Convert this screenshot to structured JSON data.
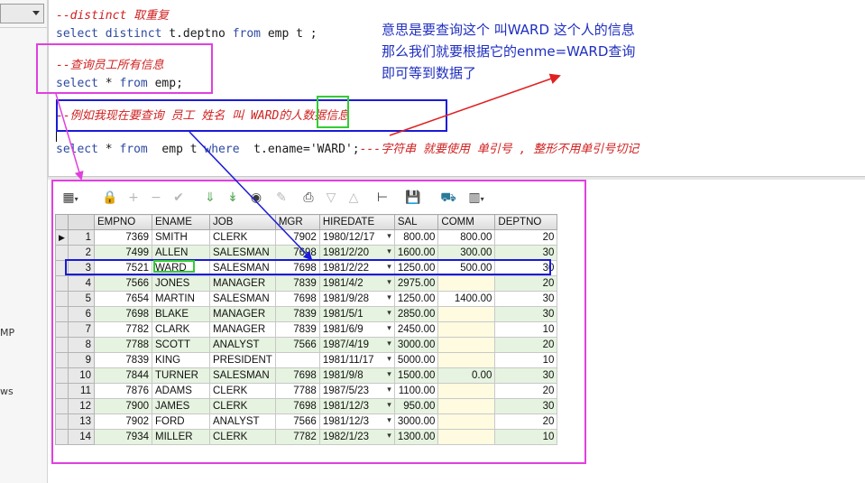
{
  "left_panel": {
    "label_mp": "MP",
    "label_ws": "ws"
  },
  "editor": {
    "line1_comment": "--distinct 取重复",
    "line2": {
      "kw1": "select distinct",
      "rest": " t.deptno ",
      "kw2": "from",
      "rest2": " emp t ;"
    },
    "line3_comment": "--查询员工所有信息",
    "line4": {
      "kw1": "select",
      "rest": " * ",
      "kw2": "from",
      "rest2": " emp;"
    },
    "line5_comment": "--例如我现在要查询 员工 姓名 叫 WARD的人数据信息",
    "line6": {
      "kw1": "select",
      "rest": " * ",
      "kw2": "from",
      "rest2": "  emp t ",
      "kw3": "where",
      "rest3": "  t.ename=",
      "str": "'WARD'",
      "rest4": ";",
      "comment": "---字符串 就要使用 单引号 , 整形不用单引号切记"
    }
  },
  "annotation": {
    "line1": "意思是要查询这个 叫WARD 这个人的信息",
    "line2": "那么我们就要根据它的enme=WARD查询",
    "line3": "即可等到数据了"
  },
  "toolbar": {
    "icons": [
      "grid-icon",
      "lock-icon",
      "add-icon",
      "remove-icon",
      "check-icon",
      "arrow-down-icon",
      "arrow-down-2-icon",
      "binoculars-icon",
      "clear-icon",
      "print-icon",
      "nav-down-icon",
      "nav-up-icon",
      "tree-icon",
      "save-icon",
      "db-icon",
      "chart-icon"
    ]
  },
  "grid": {
    "columns": [
      "EMPNO",
      "ENAME",
      "JOB",
      "MGR",
      "HIREDATE",
      "SAL",
      "COMM",
      "DEPTNO"
    ],
    "rows": [
      {
        "n": "1",
        "empno": "7369",
        "ename": "SMITH",
        "job": "CLERK",
        "mgr": "7902",
        "hiredate": "1980/12/17",
        "sal": "800.00",
        "comm": "800.00",
        "deptno": "20"
      },
      {
        "n": "2",
        "empno": "7499",
        "ename": "ALLEN",
        "job": "SALESMAN",
        "mgr": "7698",
        "hiredate": "1981/2/20",
        "sal": "1600.00",
        "comm": "300.00",
        "deptno": "30"
      },
      {
        "n": "3",
        "empno": "7521",
        "ename": "WARD",
        "job": "SALESMAN",
        "mgr": "7698",
        "hiredate": "1981/2/22",
        "sal": "1250.00",
        "comm": "500.00",
        "deptno": "30"
      },
      {
        "n": "4",
        "empno": "7566",
        "ename": "JONES",
        "job": "MANAGER",
        "mgr": "7839",
        "hiredate": "1981/4/2",
        "sal": "2975.00",
        "comm": "",
        "deptno": "20"
      },
      {
        "n": "5",
        "empno": "7654",
        "ename": "MARTIN",
        "job": "SALESMAN",
        "mgr": "7698",
        "hiredate": "1981/9/28",
        "sal": "1250.00",
        "comm": "1400.00",
        "deptno": "30"
      },
      {
        "n": "6",
        "empno": "7698",
        "ename": "BLAKE",
        "job": "MANAGER",
        "mgr": "7839",
        "hiredate": "1981/5/1",
        "sal": "2850.00",
        "comm": "",
        "deptno": "30"
      },
      {
        "n": "7",
        "empno": "7782",
        "ename": "CLARK",
        "job": "MANAGER",
        "mgr": "7839",
        "hiredate": "1981/6/9",
        "sal": "2450.00",
        "comm": "",
        "deptno": "10"
      },
      {
        "n": "8",
        "empno": "7788",
        "ename": "SCOTT",
        "job": "ANALYST",
        "mgr": "7566",
        "hiredate": "1987/4/19",
        "sal": "3000.00",
        "comm": "",
        "deptno": "20"
      },
      {
        "n": "9",
        "empno": "7839",
        "ename": "KING",
        "job": "PRESIDENT",
        "mgr": "",
        "hiredate": "1981/11/17",
        "sal": "5000.00",
        "comm": "",
        "deptno": "10"
      },
      {
        "n": "10",
        "empno": "7844",
        "ename": "TURNER",
        "job": "SALESMAN",
        "mgr": "7698",
        "hiredate": "1981/9/8",
        "sal": "1500.00",
        "comm": "0.00",
        "deptno": "30"
      },
      {
        "n": "11",
        "empno": "7876",
        "ename": "ADAMS",
        "job": "CLERK",
        "mgr": "7788",
        "hiredate": "1987/5/23",
        "sal": "1100.00",
        "comm": "",
        "deptno": "20"
      },
      {
        "n": "12",
        "empno": "7900",
        "ename": "JAMES",
        "job": "CLERK",
        "mgr": "7698",
        "hiredate": "1981/12/3",
        "sal": "950.00",
        "comm": "",
        "deptno": "30"
      },
      {
        "n": "13",
        "empno": "7902",
        "ename": "FORD",
        "job": "ANALYST",
        "mgr": "7566",
        "hiredate": "1981/12/3",
        "sal": "3000.00",
        "comm": "",
        "deptno": "20"
      },
      {
        "n": "14",
        "empno": "7934",
        "ename": "MILLER",
        "job": "CLERK",
        "mgr": "7782",
        "hiredate": "1982/1/23",
        "sal": "1300.00",
        "comm": "",
        "deptno": "10"
      }
    ]
  },
  "colors": {
    "magenta_box": "#e040e0",
    "blue_box": "#1a1ad8",
    "green_box": "#33cc33",
    "red_arrow": "#e02020",
    "alt_row": "#e6f3e0"
  }
}
